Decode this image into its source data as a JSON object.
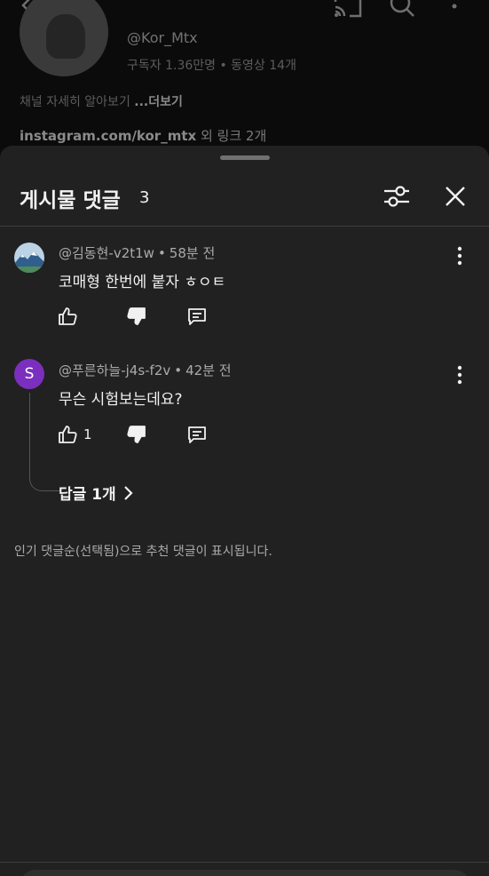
{
  "channel": {
    "handle": "@Kor_Mtx",
    "stats": "구독자 1.36만명 • 동영상 14개",
    "about_text": "채널 자세히 알아보기",
    "about_more": "...더보기",
    "link_url": "instagram.com/kor_mtx",
    "link_more": "외 링크 2개"
  },
  "sheet": {
    "title": "게시물 댓글",
    "count": "3"
  },
  "comments": [
    {
      "author": "@김동현-v2t1w",
      "time": "58분 전",
      "text": "코매형 한번에 붙자 ㅎㅇㅌ",
      "likes": "",
      "avatar_letter": ""
    },
    {
      "author": "@푸른하늘-j4s-f2v",
      "time": "42분 전",
      "text": "무슨 시험보는데요?",
      "likes": "1",
      "avatar_letter": "S",
      "replies_label": "답글 1개"
    }
  ],
  "footer_note": "인기 댓글순(선택됨)으로 추천 댓글이 표시됩니다.",
  "colors": {
    "background": "#0f0f0f",
    "sheet": "#212121",
    "avatar_purple": "#7b2fbe",
    "text_primary": "#f1f1f1",
    "text_secondary": "#aaaaaa"
  }
}
